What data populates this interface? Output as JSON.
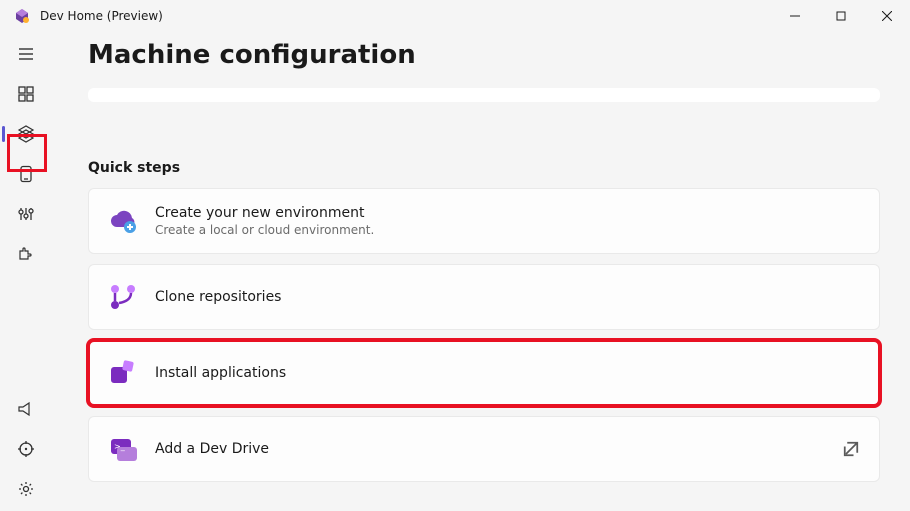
{
  "window": {
    "title": "Dev Home (Preview)"
  },
  "page": {
    "title": "Machine configuration"
  },
  "quicksteps": {
    "heading": "Quick steps",
    "cards": {
      "env": {
        "title": "Create your new environment",
        "subtitle": "Create a local or cloud environment."
      },
      "clone": {
        "title": "Clone repositories"
      },
      "install": {
        "title": "Install applications"
      },
      "drive": {
        "title": "Add a Dev Drive"
      }
    }
  }
}
